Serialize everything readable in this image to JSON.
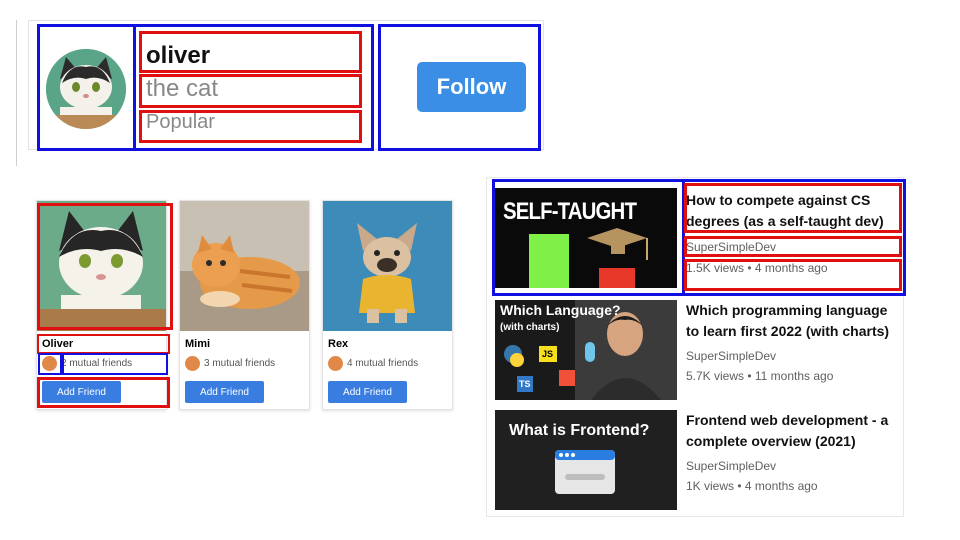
{
  "profile": {
    "name": "oliver",
    "handle": "the cat",
    "status": "Popular",
    "follow_label": "Follow"
  },
  "friends": [
    {
      "name": "Oliver",
      "mutual": "2 mutual friends",
      "button": "Add Friend"
    },
    {
      "name": "Mimi",
      "mutual": "3 mutual friends",
      "button": "Add Friend"
    },
    {
      "name": "Rex",
      "mutual": "4 mutual friends",
      "button": "Add Friend"
    }
  ],
  "videos": [
    {
      "thumb_text": "SELF-TAUGHT",
      "title": "How to compete against CS degrees (as a self-taught dev)",
      "channel": "SuperSimpleDev",
      "stats": "1.5K views • 4 months ago"
    },
    {
      "thumb_text": "Which Language?",
      "thumb_sub": "(with charts)",
      "thumb_badges": [
        "JS",
        "TS"
      ],
      "title": "Which programming language to learn first 2022 (with charts)",
      "channel": "SuperSimpleDev",
      "stats": "5.7K views • 11 months ago"
    },
    {
      "thumb_text": "What is Frontend?",
      "title": "Frontend web development - a complete overview (2021)",
      "channel": "SuperSimpleDev",
      "stats": "1K views • 4 months ago"
    }
  ],
  "colors": {
    "annotation_blue": "#1010e0",
    "annotation_red": "#e01010",
    "button_blue": "#3a8ee6"
  }
}
